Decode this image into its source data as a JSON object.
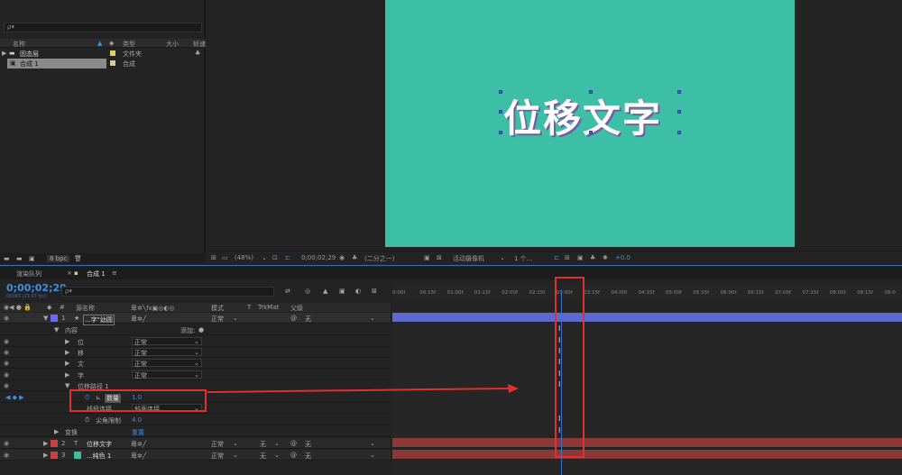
{
  "project": {
    "search_placeholder": "ρ▾",
    "columns": [
      "名称",
      "类型",
      "大小",
      "帧速"
    ],
    "items": [
      {
        "name": "固态层",
        "type": "文件夹",
        "color": "#e0d060"
      },
      {
        "name": "合成 1",
        "type": "合成",
        "color": "#d8c8a0"
      }
    ],
    "footer_bpc": "8 bpc"
  },
  "viewer": {
    "canvas_text": "位移文字",
    "canvas_color": "#3dbfa6",
    "zoom": "(48%)",
    "timecode": "0;00;02;29",
    "resolution": "(二分之一)",
    "camera": "活动摄像机",
    "views": "1 个...",
    "exposure": "+0.0"
  },
  "timeline": {
    "tabs": [
      "渲染队列",
      "合成 1"
    ],
    "timecode": "0;00;02;29",
    "fps": "00089 (29.97 fps)",
    "search_placeholder": "ρ▾",
    "columns": {
      "source": "源名称",
      "mode": "模式",
      "t": "T",
      "trkmat": "TrkMat",
      "parent": "父级"
    },
    "layers": [
      {
        "num": "1",
        "name": "...字\"幼圆",
        "mode": "正常",
        "parent": "无",
        "color": "#6a6af0"
      },
      {
        "label": "内容",
        "add": "添加:"
      },
      {
        "label": "位",
        "mode": "正常"
      },
      {
        "label": "移",
        "mode": "正常"
      },
      {
        "label": "文",
        "mode": "正常"
      },
      {
        "label": "字",
        "mode": "正常"
      },
      {
        "label": "位移路径 1"
      },
      {
        "label": "数量",
        "value": "1.0"
      },
      {
        "label": "线段连接",
        "value": "斜面连接"
      },
      {
        "label": "尖角限制",
        "value": "4.0"
      },
      {
        "label": "变换",
        "reset": "重置"
      },
      {
        "num": "2",
        "name": "位移文字",
        "mode": "正常",
        "trkmat": "无",
        "parent": "无",
        "color": "#c84040"
      },
      {
        "num": "3",
        "name": "...纯色 1",
        "mode": "正常",
        "trkmat": "无",
        "parent": "无",
        "color": "#c84040"
      }
    ],
    "ruler_ticks": [
      "0:00f",
      "00:15f",
      "01:00f",
      "01:15f",
      "02:00f",
      "02:15f",
      "03:00f",
      "03:15f",
      "04:00f",
      "04:15f",
      "05:00f",
      "05:15f",
      "06:00f",
      "06:15f",
      "07:00f",
      "07:15f",
      "08:00f",
      "08:15f",
      "09:0"
    ]
  }
}
